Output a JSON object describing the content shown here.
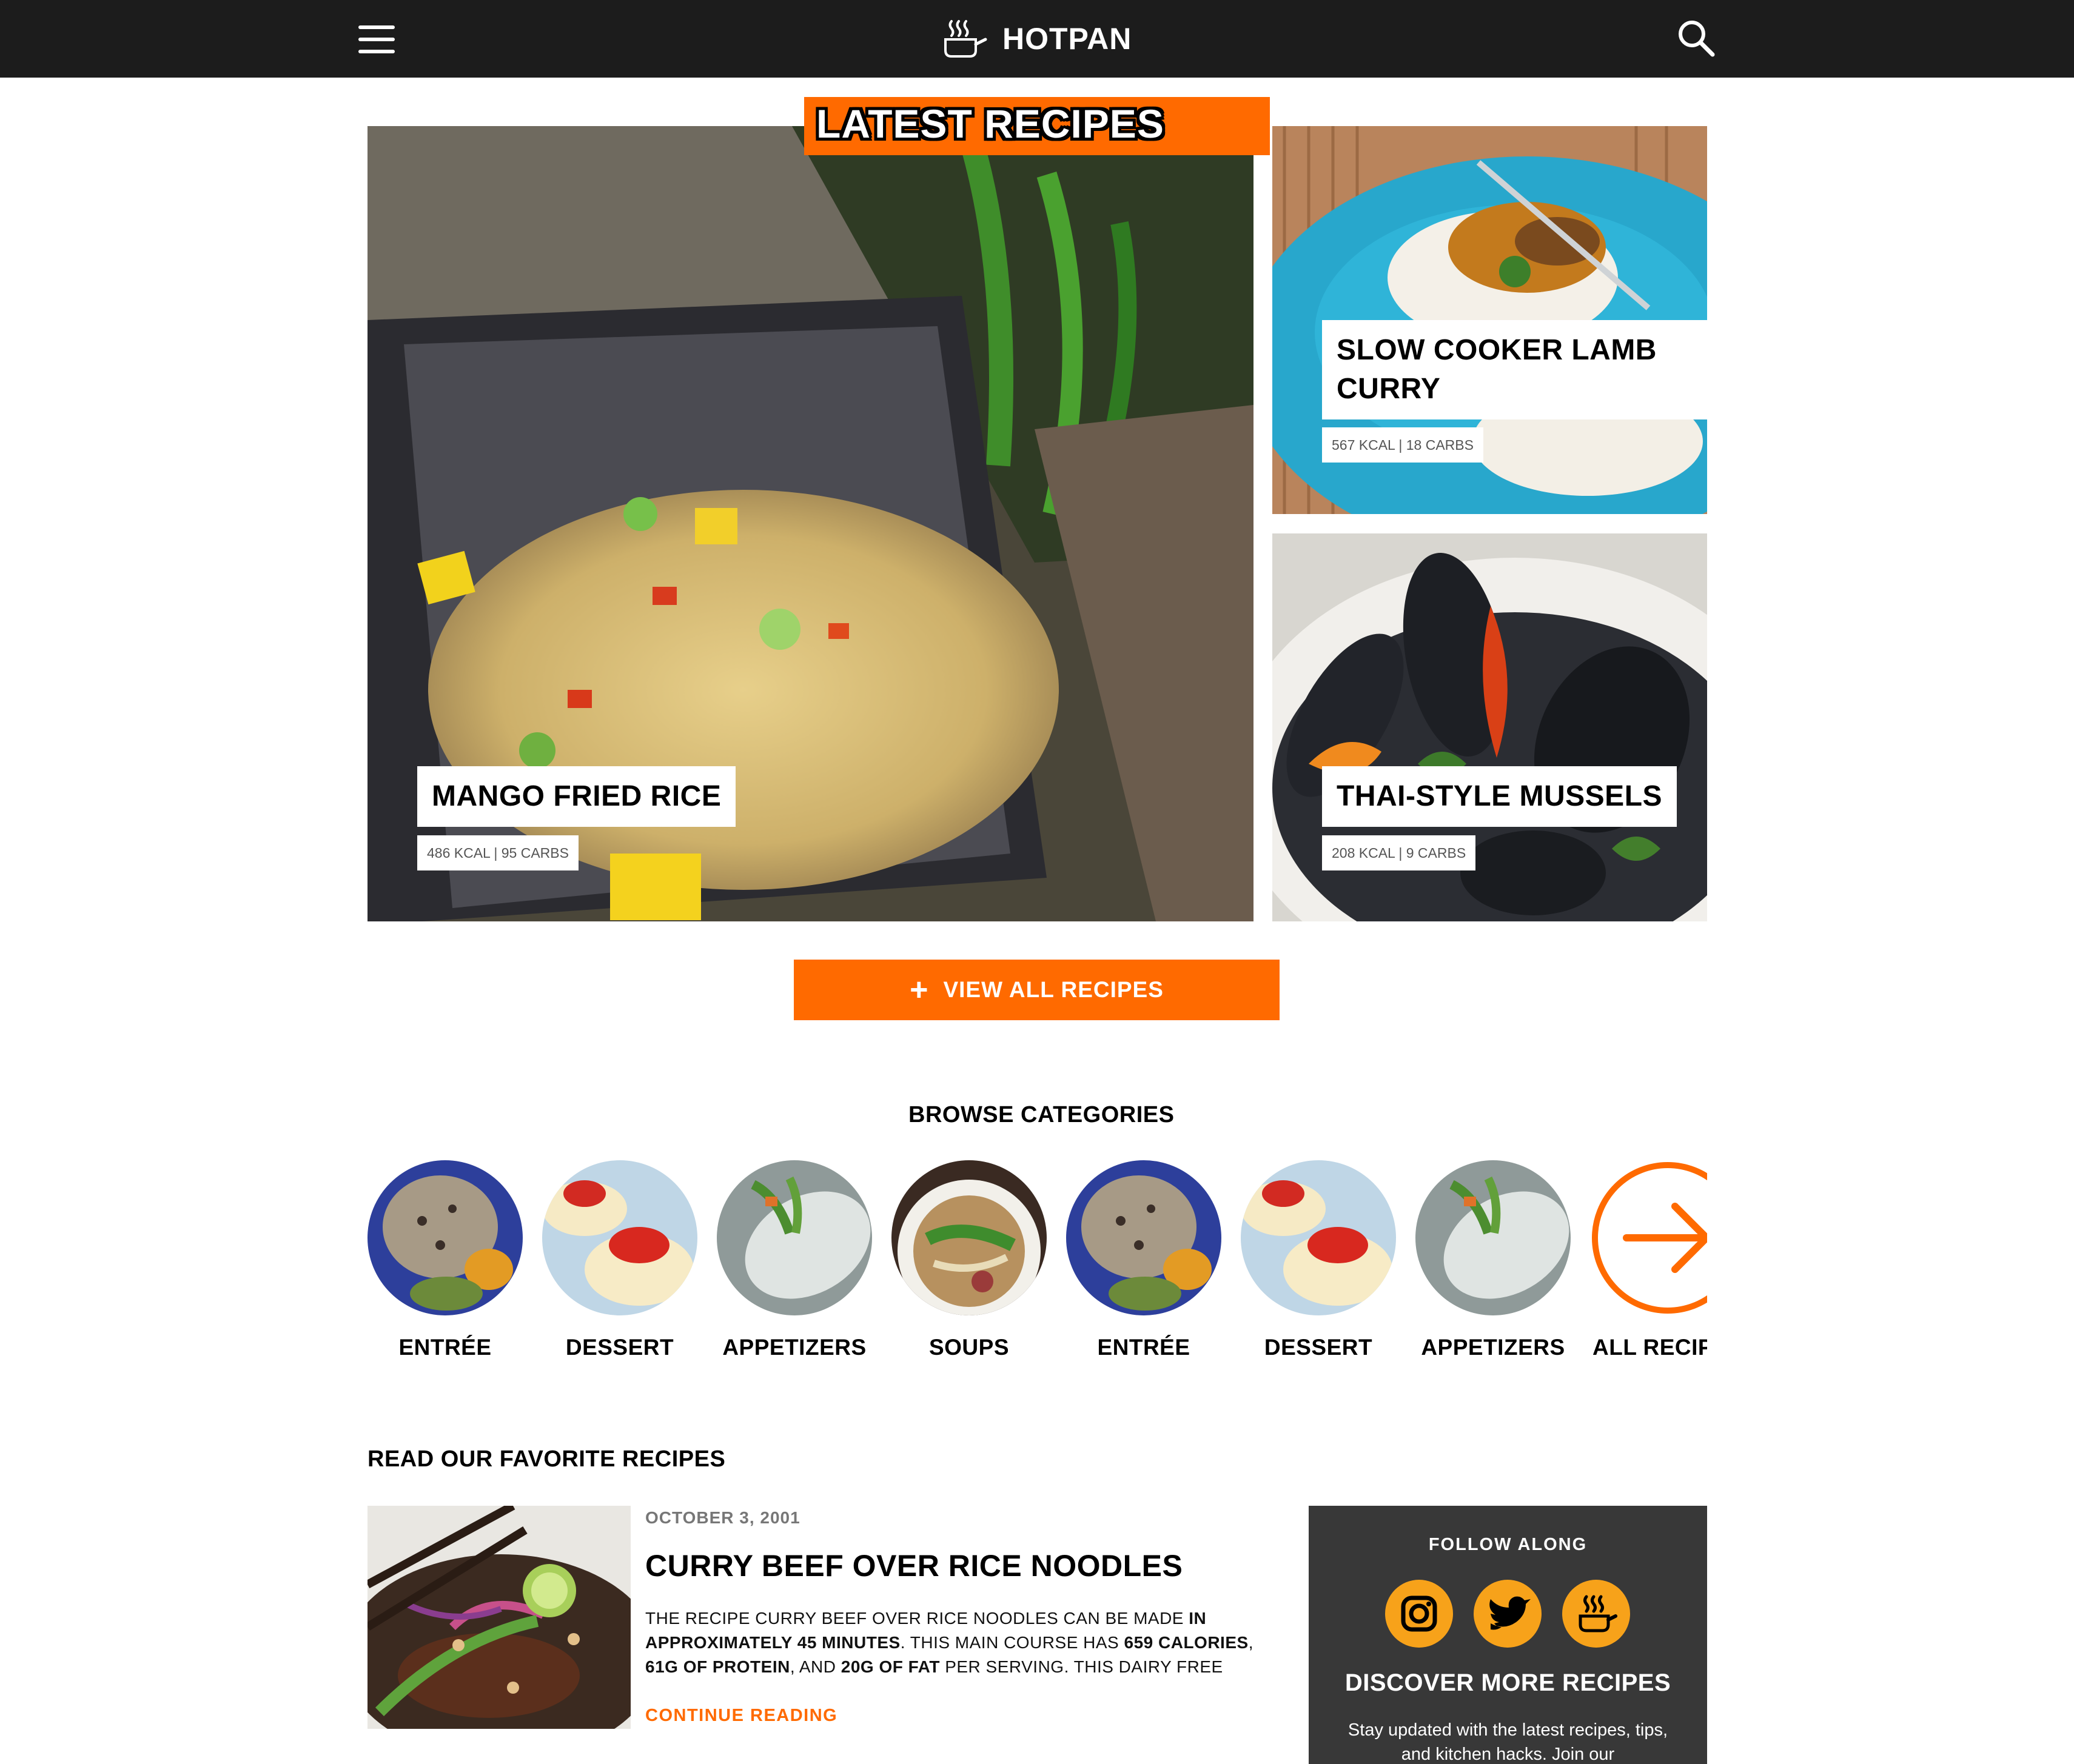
{
  "header": {
    "brand": "HOTPAN",
    "menu_icon": "hamburger-menu-icon",
    "logo_icon": "steaming-pan-icon",
    "search_icon": "search-icon"
  },
  "latest": {
    "heading": "LATEST RECIPES",
    "cards": [
      {
        "title": "MANGO FRIED RICE",
        "meta": "486 KCAL | 95 CARBS"
      },
      {
        "title": "SLOW COOKER LAMB CURRY",
        "meta": "567 KCAL | 18 CARBS"
      },
      {
        "title": "THAI-STYLE MUSSELS",
        "meta": "208 KCAL | 9 CARBS"
      }
    ],
    "view_all": "VIEW ALL RECIPES",
    "view_all_icon": "plus-icon"
  },
  "categories": {
    "heading": "BROWSE CATEGORIES",
    "items": [
      {
        "label": "ENTRÉE"
      },
      {
        "label": "DESSERT"
      },
      {
        "label": "APPETIZERS"
      },
      {
        "label": "SOUPS"
      },
      {
        "label": "ENTRÉE"
      },
      {
        "label": "DESSERT"
      },
      {
        "label": "APPETIZERS"
      },
      {
        "label": "ALL RECIPES",
        "icon": "arrow-right-circle-icon"
      }
    ]
  },
  "favorites": {
    "heading": "READ OUR FAVORITE RECIPES",
    "post": {
      "date": "OCTOBER 3, 2001",
      "title": "CURRY BEEF OVER RICE NOODLES",
      "excerpt_1": "THE RECIPE CURRY BEEF OVER RICE NOODLES CAN BE MADE ",
      "excerpt_b1": "IN APPROXIMATELY 45 MINUTES",
      "excerpt_2": ". THIS MAIN COURSE HAS ",
      "excerpt_b2": "659 CALORIES",
      "excerpt_3": ", ",
      "excerpt_b3": "61G OF PROTEIN",
      "excerpt_4": ", AND ",
      "excerpt_b4": "20G OF FAT",
      "excerpt_5": " PER SERVING. THIS DAIRY FREE",
      "continue": "CONTINUE READING"
    }
  },
  "sidebar": {
    "follow_title": "FOLLOW ALONG",
    "social": [
      "instagram-icon",
      "twitter-icon",
      "hotpan-icon"
    ],
    "discover_title": "DISCOVER MORE RECIPES",
    "discover_text": "Stay updated with the latest recipes, tips, and kitchen hacks. Join our"
  },
  "colors": {
    "accent": "#ff6a00",
    "header_bg": "#1c1c1c",
    "sidebar_bg": "#383838",
    "social_bg": "#f7a21a"
  }
}
